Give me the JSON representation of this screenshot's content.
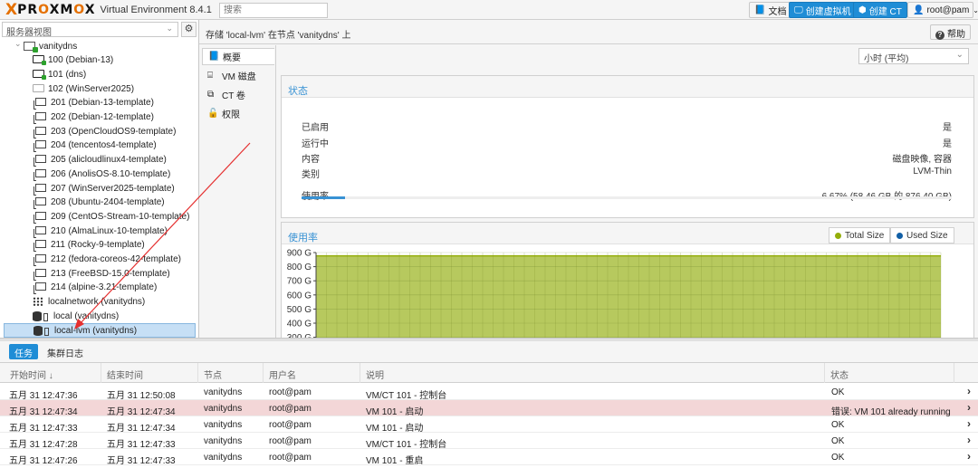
{
  "topbar": {
    "logo_x": "X",
    "logo_word_a": "PR",
    "logo_word_b": "O",
    "logo_word_c": "XM",
    "logo_word_d": "O",
    "logo_word_e": "X",
    "version": "Virtual Environment 8.4.1",
    "search_placeholder": "搜索",
    "docs_label": "文档",
    "create_vm_label": "创建虚拟机",
    "create_ct_label": "创建 CT",
    "user_label": "root@pam"
  },
  "left": {
    "view_selector": "服务器视图",
    "tree": [
      {
        "label": "vanitydns",
        "kind": "node"
      },
      {
        "label": "100 (Debian-13)",
        "kind": "vm-running"
      },
      {
        "label": "101 (dns)",
        "kind": "vm-running"
      },
      {
        "label": "102 (WinServer2025)",
        "kind": "vm-stopped"
      },
      {
        "label": "201 (Debian-13-template)",
        "kind": "template"
      },
      {
        "label": "202 (Debian-12-template)",
        "kind": "template"
      },
      {
        "label": "203 (OpenCloudOS9-template)",
        "kind": "template"
      },
      {
        "label": "204 (tencentos4-template)",
        "kind": "template"
      },
      {
        "label": "205 (alicloudlinux4-template)",
        "kind": "template"
      },
      {
        "label": "206 (AnolisOS-8.10-template)",
        "kind": "template"
      },
      {
        "label": "207 (WinServer2025-template)",
        "kind": "template"
      },
      {
        "label": "208 (Ubuntu-2404-template)",
        "kind": "template"
      },
      {
        "label": "209 (CentOS-Stream-10-template)",
        "kind": "template"
      },
      {
        "label": "210 (AlmaLinux-10-template)",
        "kind": "template"
      },
      {
        "label": "211 (Rocky-9-template)",
        "kind": "template"
      },
      {
        "label": "212 (fedora-coreos-42-template)",
        "kind": "template"
      },
      {
        "label": "213 (FreeBSD-15.0-template)",
        "kind": "template"
      },
      {
        "label": "214 (alpine-3.21-template)",
        "kind": "template"
      },
      {
        "label": "localnetwork (vanitydns)",
        "kind": "network"
      },
      {
        "label": "local (vanitydns)",
        "kind": "storage"
      },
      {
        "label": "local-lvm (vanitydns)",
        "kind": "storage-selected"
      }
    ]
  },
  "content": {
    "title": "存储 'local-lvm' 在节点 'vanitydns' 上",
    "help_label": "帮助",
    "nav": [
      {
        "label": "概要",
        "icon": "book-icon",
        "active": true
      },
      {
        "label": "VM 磁盘",
        "icon": "hdd-icon",
        "active": false
      },
      {
        "label": "CT 卷",
        "icon": "ct-volume-icon",
        "active": false
      },
      {
        "label": "权限",
        "icon": "unlock-icon",
        "active": false
      }
    ],
    "time_selector": "小时 (平均)",
    "status": {
      "heading": "状态",
      "rows": [
        {
          "key": "已启用",
          "value": "是"
        },
        {
          "key": "运行中",
          "value": "是"
        },
        {
          "key": "内容",
          "value": "磁盘映像, 容器"
        },
        {
          "key": "类别",
          "value": "LVM-Thin"
        }
      ],
      "usage_key": "使用率",
      "usage_value": "6.67% (58.46 GB 的 876.40 GB)",
      "usage_fraction": 0.0667
    }
  },
  "chart_data": {
    "type": "area",
    "title": "使用率",
    "legend_placement": "top-right",
    "y_ticks": [
      "900 G",
      "800 G",
      "700 G",
      "600 G",
      "500 G",
      "400 G",
      "300 G"
    ],
    "ylim": [
      300,
      900
    ],
    "y_unit": "G",
    "series": [
      {
        "name": "Total Size",
        "value": 876.4,
        "color": "#94ae0a"
      },
      {
        "name": "Used Size",
        "value": 58.46,
        "color": "#115fa6"
      }
    ],
    "grid": true
  },
  "bottom": {
    "tabs": [
      {
        "label": "任务",
        "active": true
      },
      {
        "label": "集群日志",
        "active": false
      }
    ],
    "headers": [
      "开始时间 ↓",
      "结束时间",
      "节点",
      "用户名",
      "说明",
      "状态"
    ],
    "rows": [
      {
        "start": "五月 31 12:47:36",
        "end": "五月 31 12:50:08",
        "node": "vanitydns",
        "user": "root@pam",
        "desc": "VM/CT 101 - 控制台",
        "status": "OK",
        "error": false
      },
      {
        "start": "五月 31 12:47:34",
        "end": "五月 31 12:47:34",
        "node": "vanitydns",
        "user": "root@pam",
        "desc": "VM 101 - 启动",
        "status": "错误: VM 101 already running",
        "error": true
      },
      {
        "start": "五月 31 12:47:33",
        "end": "五月 31 12:47:34",
        "node": "vanitydns",
        "user": "root@pam",
        "desc": "VM 101 - 启动",
        "status": "OK",
        "error": false
      },
      {
        "start": "五月 31 12:47:28",
        "end": "五月 31 12:47:33",
        "node": "vanitydns",
        "user": "root@pam",
        "desc": "VM/CT 101 - 控制台",
        "status": "OK",
        "error": false
      },
      {
        "start": "五月 31 12:47:26",
        "end": "五月 31 12:47:33",
        "node": "vanitydns",
        "user": "root@pam",
        "desc": "VM 101 - 重启",
        "status": "OK",
        "error": false
      }
    ]
  }
}
